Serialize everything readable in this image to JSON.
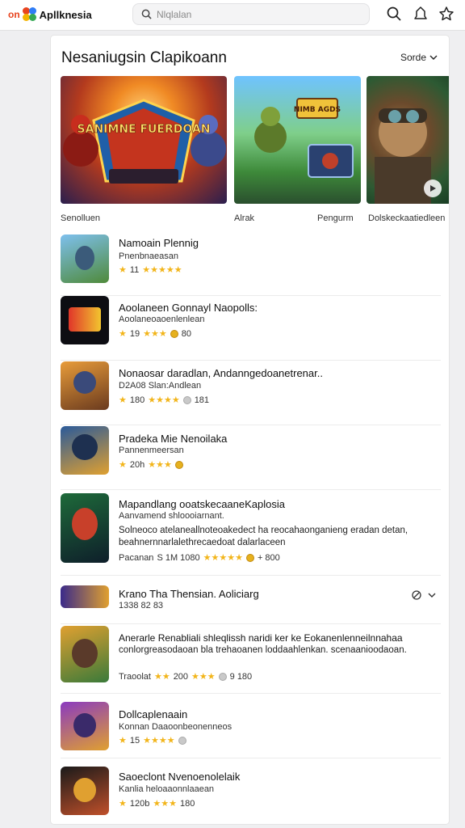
{
  "topbar": {
    "brand_prefix": "on",
    "brand_name": "Apllknesia",
    "search_placeholder": "Nlqlalan",
    "brand_colors": [
      "#e8441f",
      "#2f7cf6",
      "#f4b400",
      "#34a853"
    ],
    "icons": [
      "search-icon",
      "bell-icon",
      "star-icon"
    ]
  },
  "panel": {
    "title": "Nesaniugsin Clapikoann",
    "sort_label": "Sorde",
    "banners": [
      {
        "art_text": "SANIMNE FUERDOAN",
        "caption": "Senolluen"
      },
      {
        "art_text": "NIMB AGDS",
        "caption": "Alrak"
      },
      {
        "art_text": "",
        "caption": "Pengurm"
      }
    ],
    "extra_caption": "Dolskeckaatiedleen",
    "items": [
      {
        "name": "Namoain Plennig",
        "subtitle": "Pnenbnaeasan",
        "rating_text": "11",
        "stars": "★★★★★",
        "extra": ""
      },
      {
        "name": "Aoolaneen Gonnayl Naopolls:",
        "subtitle": "Aoolaneoaoenlenlean",
        "rating_text": "19",
        "stars": "★★★",
        "extra": "80"
      },
      {
        "name": "Nonaosar daradlan, Andanngedoanetrenar..",
        "subtitle": "D2A08 Slan:Andlean",
        "rating_text": "180",
        "stars": "★★★★",
        "extra": "181"
      },
      {
        "name": "Pradeka Mie Nenoilaka",
        "subtitle": "Pannenmeersan",
        "rating_text": "20h",
        "stars": "★★★",
        "extra": ""
      },
      {
        "name": "Mapandlang ooatskecaaneKaplosia",
        "subtitle": "Aanvamend shloooiarnant.",
        "desc": "Solneoco atelaneallnoteoakedect ha reocahaonganieng eradan detan, beahnernnarlalethrecaedoat dalarlaceen",
        "rating_prefix": "Pacanan",
        "rating_text": "S 1M 1080",
        "stars": "★★★★★",
        "extra": "+ 800"
      },
      {
        "name": "Krano Tha Thensian. Aoliciarg",
        "subtitle": "1338 82 83",
        "rating_text": "",
        "stars": "",
        "extra": ""
      },
      {
        "name": "Anerarle Renabliali shleqlissh  naridi ker ke Eokanenlenneilnnahaa",
        "desc": "conlorgreasodaoan bla trehaoanen loddaahlenkan. scenaanioodaoan.",
        "rating_prefix": "Traoolat",
        "rating_text": "200",
        "stars": "★★★",
        "extra": "9 180"
      },
      {
        "name": "Dollcaplenaain",
        "subtitle": "Konnan Daaoonbeonenneos",
        "rating_text": "15",
        "stars": "★★★★",
        "extra": ""
      },
      {
        "name": "Saoeclont Nvenoenolelaik",
        "subtitle": "Kanlia heloaaonnlaaean",
        "rating_text": "120b",
        "stars": "★★★",
        "extra": "180"
      }
    ]
  }
}
